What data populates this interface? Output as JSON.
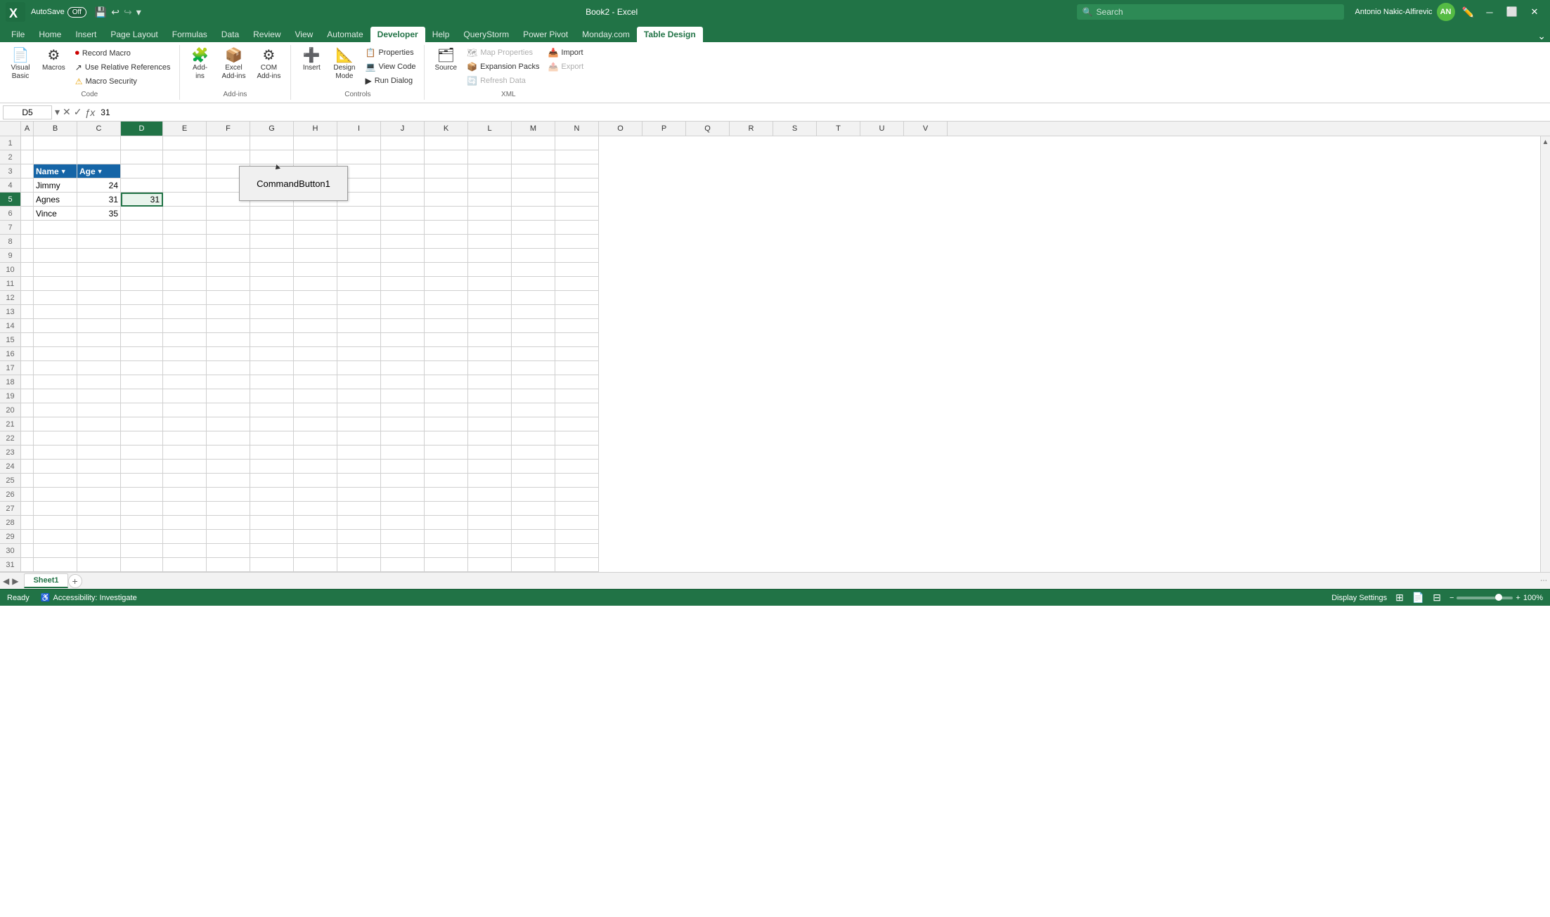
{
  "titleBar": {
    "appName": "Book2 - Excel",
    "autosave": "AutoSave",
    "autosaveState": "Off",
    "user": "Antonio Nakic-Alfirevic",
    "userInitials": "AN"
  },
  "search": {
    "placeholder": "Search"
  },
  "ribbonTabs": [
    {
      "label": "File",
      "active": false
    },
    {
      "label": "Home",
      "active": false
    },
    {
      "label": "Insert",
      "active": false
    },
    {
      "label": "Page Layout",
      "active": false
    },
    {
      "label": "Formulas",
      "active": false
    },
    {
      "label": "Data",
      "active": false
    },
    {
      "label": "Review",
      "active": false
    },
    {
      "label": "View",
      "active": false
    },
    {
      "label": "Automate",
      "active": false
    },
    {
      "label": "Developer",
      "active": true
    },
    {
      "label": "Help",
      "active": false
    },
    {
      "label": "QueryStorm",
      "active": false
    },
    {
      "label": "Power Pivot",
      "active": false
    },
    {
      "label": "Monday.com",
      "active": false
    },
    {
      "label": "Table Design",
      "active": false,
      "highlight": true
    }
  ],
  "ribbonGroups": {
    "code": {
      "label": "Code",
      "items": [
        {
          "id": "visual-basic",
          "label": "Visual\nBasic",
          "icon": "📄"
        },
        {
          "id": "macros",
          "label": "Macros",
          "icon": "▶"
        },
        {
          "id": "record-macro",
          "label": "Record Macro",
          "small": true,
          "icon": "⏺"
        },
        {
          "id": "relative-refs",
          "label": "Use Relative References",
          "small": true,
          "icon": "↗"
        },
        {
          "id": "macro-security",
          "label": "Macro Security",
          "small": true,
          "icon": "⚠"
        }
      ]
    },
    "addIns": {
      "label": "Add-ins",
      "items": [
        {
          "id": "add-ins",
          "label": "Add-\nins",
          "icon": "🧩"
        },
        {
          "id": "excel-add-ins",
          "label": "Excel\nAdd-ins",
          "icon": "📦"
        },
        {
          "id": "com-add-ins",
          "label": "COM\nAdd-ins",
          "icon": "⚙"
        }
      ]
    },
    "controls": {
      "label": "Controls",
      "items": [
        {
          "id": "insert-control",
          "label": "Insert",
          "icon": "➕"
        },
        {
          "id": "design-mode",
          "label": "Design\nMode",
          "icon": "📐"
        },
        {
          "id": "properties",
          "label": "Properties",
          "small": true,
          "icon": "📋"
        },
        {
          "id": "view-code",
          "label": "View Code",
          "small": true,
          "icon": "💻"
        },
        {
          "id": "run-dialog",
          "label": "Run Dialog",
          "small": true,
          "icon": "▶"
        }
      ]
    },
    "xml": {
      "label": "XML",
      "items": [
        {
          "id": "source",
          "label": "Source",
          "icon": "🗂"
        },
        {
          "id": "map-properties",
          "label": "Map Properties",
          "small": true,
          "icon": "🗺",
          "disabled": true
        },
        {
          "id": "expansion-packs",
          "label": "Expansion Packs",
          "small": true,
          "icon": "📦",
          "disabled": false
        },
        {
          "id": "refresh-data",
          "label": "Refresh Data",
          "small": true,
          "icon": "🔄",
          "disabled": true
        },
        {
          "id": "import",
          "label": "Import",
          "small": true,
          "icon": "📥"
        },
        {
          "id": "export",
          "label": "Export",
          "small": true,
          "icon": "📤",
          "disabled": true
        }
      ]
    }
  },
  "formulaBar": {
    "cellRef": "D5",
    "formula": "31"
  },
  "columns": [
    "A",
    "B",
    "C",
    "D",
    "E",
    "F",
    "G",
    "H",
    "I",
    "J",
    "K",
    "L",
    "M",
    "N",
    "O",
    "P",
    "Q",
    "R",
    "S",
    "T",
    "U",
    "V"
  ],
  "selectedCell": {
    "row": 5,
    "col": "D"
  },
  "tableData": {
    "headerRow": 3,
    "headers": [
      "Name",
      "Age"
    ],
    "rows": [
      {
        "name": "Jimmy",
        "age": 24
      },
      {
        "name": "Agnes",
        "age": 31
      },
      {
        "name": "Vince",
        "age": 35
      }
    ]
  },
  "commandButton": {
    "label": "CommandButton1"
  },
  "sheetTabs": [
    {
      "label": "Sheet1",
      "active": true
    }
  ],
  "statusBar": {
    "status": "Ready",
    "accessibility": "Accessibility: Investigate",
    "displaySettings": "Display Settings",
    "zoom": "100%"
  }
}
